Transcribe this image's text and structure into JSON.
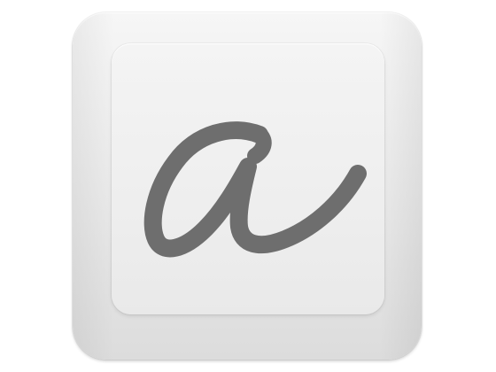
{
  "icon": {
    "glyph": "a",
    "glyph_color": "#6e6e6e",
    "keycap_color": "#f0f0f0"
  }
}
